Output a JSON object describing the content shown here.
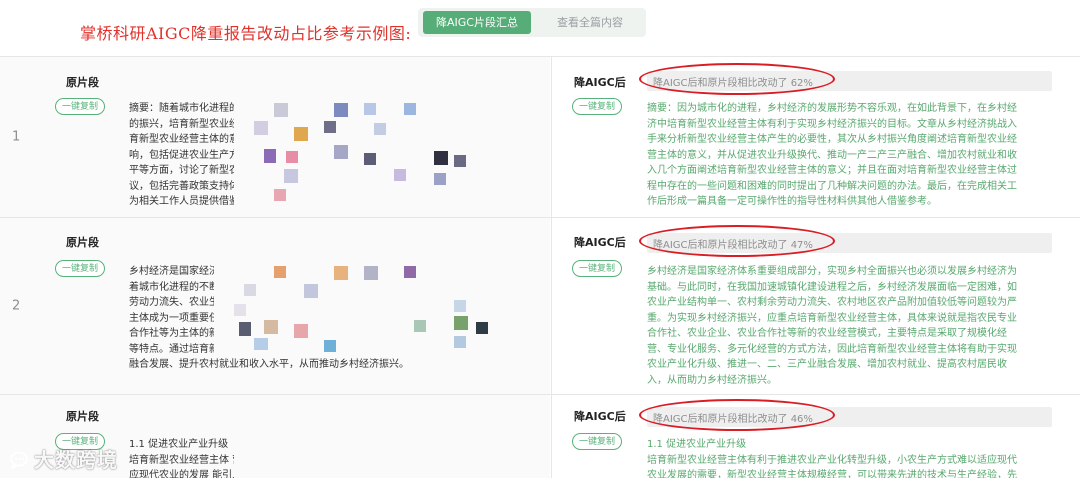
{
  "header": {
    "title": "掌桥科研AIGC降重报告改动占比参考示例图:",
    "tabs": [
      {
        "label": "降AIGC片段汇总",
        "active": true
      },
      {
        "label": "查看全篇内容",
        "active": false
      }
    ]
  },
  "rows": [
    {
      "index": "1",
      "orig_label": "原片段",
      "new_label": "降AIGC后",
      "copy_label": "一键复制",
      "ratio_text": "降AIGC后和原片段相比改动了 62%",
      "orig_lines": [
        "摘要：随着城市化进程的加快，乡村经济发展面临挑战。为了促进乡村经济",
        "的振兴，培育新型农业经营主体成为应对乡村经济面临的挑战和培",
        "育新型农业经营主体的意义。本文旨在分析新型农业经营主体对乡村经济的影",
        "响，包括促进农业生产方式转变，推动农业产业化，促进农村就业和收入水",
        "平等方面，讨论了新型农业经营主体所面临的问题，提出相应的对策和建",
        "议，包括完善政策支持体系，加强人才培养，推进农村土地制度改革等，",
        "为相关工作人员提供借鉴参考。"
      ],
      "new_lines": [
        "摘要：因为城市化的进程，乡村经济的发展形势不容乐观，在如此背景下，在乡村经",
        "济中培育新型农业经营主体有利于实现乡村经济振兴的目标。文章从乡村经济挑战入",
        "手来分析新型农业经营主体产生的必要性，其次从乡村振兴角度阐述培育新型农业经",
        "营主体的意义，并从促进农业升级换代、推动一产二产三产融合、增加农村就业和收",
        "入几个方面阐述培育新型农业经营主体的意义；并且在面对培育新型农业经营主体过",
        "程中存在的一些问题和困难的同时提出了几种解决问题的办法。最后，在完成相关工",
        "作后形成一篇具备一定可操作性的指导性材料供其他人借鉴参考。"
      ]
    },
    {
      "index": "2",
      "orig_label": "原片段",
      "new_label": "降AIGC后",
      "copy_label": "一键复制",
      "ratio_text": "降AIGC后和原片段相比改动了 47%",
      "orig_lines": [
        "乡村经济是国家经济的重要组成部分，也是实现乡村振兴的关键环节。然而，随",
        "着城市化进程的不断推进，乡村经济面临着农业结构单一、农村",
        "劳动力流失、农业生产效率低等问题。因此，培育新型农业经营",
        "主体成为一项重要任务。新型农业经营主体包括家庭农场、农业",
        "合作社等为主体的新型经营模式，具有规模化、专业化、市场化",
        "等特点。通过培育新型农业经营主体，可以促进农业升级，推动农村一二三产业",
        "融合发展、提升农村就业和收入水平，从而推动乡村经济振兴。"
      ],
      "new_lines": [
        "乡村经济是国家经济体系重要组成部分，实现乡村全面振兴也必须以发展乡村经济为",
        "基础。与此同时，在我国加速城镇化建设进程之后，乡村经济发展面临一定困难，如",
        "农业产业结构单一、农村剩余劳动力流失、农村地区农产品附加值较低等问题较为严",
        "重。为实现乡村经济振兴，应重点培育新型农业经营主体，具体来说就是指农民专业",
        "合作社、农业企业、农业合作社等新的农业经营模式，主要特点是采取了规模化经",
        "营、专业化服务、多元化经营的方式方法，因此培育新型农业经营主体将有助于实现",
        "农业产业化升级、推进一、二、三产业融合发展、增加农村就业、提高农村居民收",
        "入，从而助力乡村经济振兴。"
      ]
    },
    {
      "index": "",
      "orig_label": "原片段",
      "new_label": "降AIGC后",
      "copy_label": "一键复制",
      "ratio_text": "降AIGC后和原片段相比改动了 46%",
      "orig_lines": [
        "1.1 促进农业产业升级",
        "培育新型农业经营主体                                                                    营模式难以适",
        "应现代农业的发展                                                                          能引入先进的"
      ],
      "new_lines": [
        "1.1 促进农业产业升级",
        "培育新型农业经营主体有利于推进农业产业化转型升级，小农生产方式难以适应现代",
        "农业发展的需要，新型农业经营主体规模经营，可以带来先进的技术与生产经验，先"
      ]
    }
  ],
  "watermark": {
    "text": "大数跨境",
    "icon": "chat-bubble-icon"
  },
  "colors": {
    "title_red": "#e0312b",
    "accent_green": "#56ad78",
    "new_text_green": "#58a86e",
    "oval_red": "#d91d24"
  }
}
